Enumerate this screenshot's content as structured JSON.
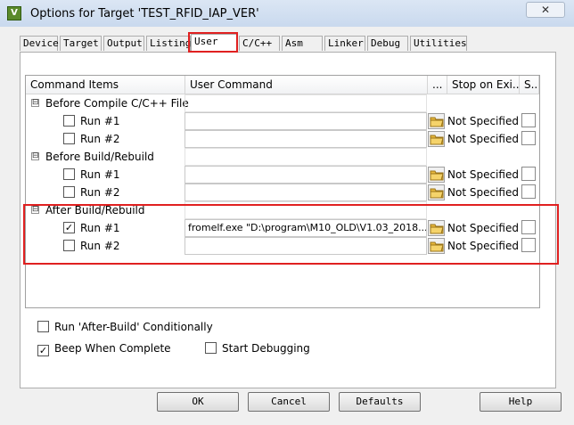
{
  "window": {
    "title": "Options for Target 'TEST_RFID_IAP_VER'",
    "app_icon_glyph": "V",
    "close_glyph": "✕"
  },
  "tabs": [
    {
      "label": "Device"
    },
    {
      "label": "Target"
    },
    {
      "label": "Output"
    },
    {
      "label": "Listing"
    },
    {
      "label": "User",
      "active": true
    },
    {
      "label": "C/C++"
    },
    {
      "label": "Asm"
    },
    {
      "label": "Linker"
    },
    {
      "label": "Debug"
    },
    {
      "label": "Utilities"
    }
  ],
  "grid": {
    "headers": {
      "command_items": "Command Items",
      "user_command": "User Command",
      "browse": "...",
      "stop_on_exit": "Stop on Exi...",
      "s": "S..."
    },
    "groups": [
      {
        "label": "Before Compile C/C++ File",
        "expander": "⊟",
        "rows": [
          {
            "label": "Run #1",
            "checked": false,
            "command": "",
            "stop": "Not Specified"
          },
          {
            "label": "Run #2",
            "checked": false,
            "command": "",
            "stop": "Not Specified"
          }
        ]
      },
      {
        "label": "Before Build/Rebuild",
        "expander": "⊟",
        "rows": [
          {
            "label": "Run #1",
            "checked": false,
            "command": "",
            "stop": "Not Specified"
          },
          {
            "label": "Run #2",
            "checked": false,
            "command": "",
            "stop": "Not Specified"
          }
        ]
      },
      {
        "label": "After Build/Rebuild",
        "expander": "⊟",
        "rows": [
          {
            "label": "Run #1",
            "checked": true,
            "command": "fromelf.exe  \"D:\\program\\M10_OLD\\V1.03_2018...",
            "stop": "Not Specified"
          },
          {
            "label": "Run #2",
            "checked": false,
            "command": "",
            "stop": "Not Specified"
          }
        ]
      }
    ]
  },
  "options": {
    "run_after_build": {
      "label": "Run 'After-Build' Conditionally",
      "checked": false
    },
    "beep": {
      "label": "Beep When Complete",
      "checked": true
    },
    "start_debugging": {
      "label": "Start Debugging",
      "checked": false
    }
  },
  "buttons": {
    "ok": "OK",
    "cancel": "Cancel",
    "defaults": "Defaults",
    "help": "Help"
  },
  "colors": {
    "highlight": "#e02020",
    "folder": "#e8b93c"
  },
  "icons": {
    "browse": "folder-icon",
    "check": "✓"
  }
}
